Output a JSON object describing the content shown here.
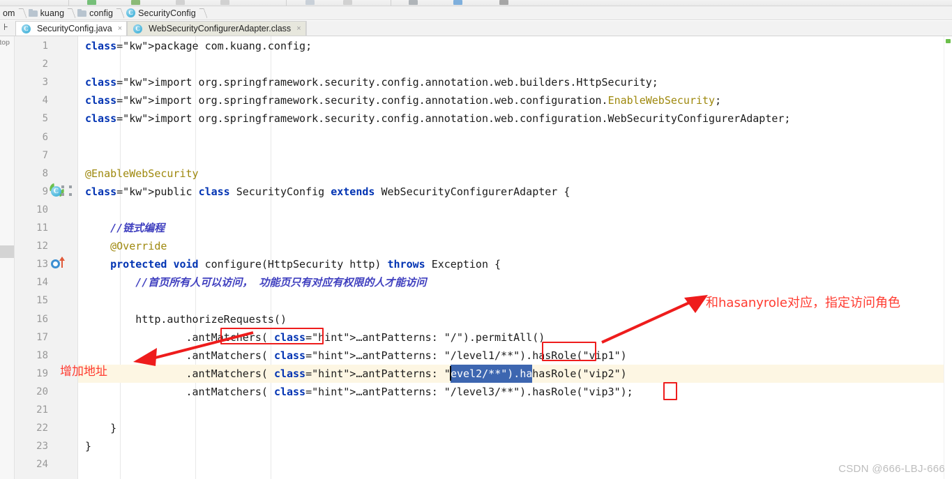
{
  "window": {
    "watermark": "CSDN @666-LBJ-666",
    "left_rail_label": "top"
  },
  "toolbar": {
    "icons": [
      "run-icon",
      "debug-icon",
      "stop-icon",
      "coverage-icon",
      "search-icon",
      "settings-icon",
      "vcs-icon",
      "build-icon",
      "profile-icon"
    ]
  },
  "breadcrumb": {
    "items": [
      {
        "label": "om",
        "icon": "none"
      },
      {
        "label": "kuang",
        "icon": "folder-icon"
      },
      {
        "label": "config",
        "icon": "folder-icon"
      },
      {
        "label": "SecurityConfig",
        "icon": "class-icon"
      }
    ]
  },
  "tabs": [
    {
      "label": "SecurityConfig.java",
      "icon": "java-class-icon",
      "active": true,
      "close": "×"
    },
    {
      "label": "WebSecurityConfigurerAdapter.class",
      "icon": "compiled-class-icon",
      "active": false,
      "close": "×"
    }
  ],
  "editor": {
    "current_line": 19,
    "lines": [
      {
        "n": "1",
        "text": "package com.kuang.config;"
      },
      {
        "n": "2",
        "text": ""
      },
      {
        "n": "3",
        "text": "import org.springframework.security.config.annotation.web.builders.HttpSecurity;"
      },
      {
        "n": "4",
        "text": "import org.springframework.security.config.annotation.web.configuration.EnableWebSecurity;"
      },
      {
        "n": "5",
        "text": "import org.springframework.security.config.annotation.web.configuration.WebSecurityConfigurerAdapter;"
      },
      {
        "n": "6",
        "text": ""
      },
      {
        "n": "7",
        "text": ""
      },
      {
        "n": "8",
        "text": "@EnableWebSecurity"
      },
      {
        "n": "9",
        "text": "public class SecurityConfig extends WebSecurityConfigurerAdapter {"
      },
      {
        "n": "10",
        "text": ""
      },
      {
        "n": "11",
        "text": "    //链式编程"
      },
      {
        "n": "12",
        "text": "    @Override"
      },
      {
        "n": "13",
        "text": "    protected void configure(HttpSecurity http) throws Exception {"
      },
      {
        "n": "14",
        "text": "        //首页所有人可以访问， 功能页只有对应有权限的人才能访问"
      },
      {
        "n": "15",
        "text": ""
      },
      {
        "n": "16",
        "text": "        http.authorizeRequests()"
      },
      {
        "n": "17",
        "text": "                .antMatchers( ...antPatterns: \"/\").permitAll()"
      },
      {
        "n": "18",
        "text": "                .antMatchers( ...antPatterns: \"/level1/**\").hasRole(\"vip1\")"
      },
      {
        "n": "19",
        "text": "                .antMatchers( ...antPatterns: \"/level2/**\").hasRole(\"vip2\")"
      },
      {
        "n": "20",
        "text": "                .antMatchers( ...antPatterns: \"/level3/**\").hasRole(\"vip3\");"
      },
      {
        "n": "21",
        "text": ""
      },
      {
        "n": "22",
        "text": "    }"
      },
      {
        "n": "23",
        "text": "}"
      },
      {
        "n": "24",
        "text": ""
      }
    ],
    "param_hint": "...antPatterns:",
    "selection_text": "evel2/**\").ha"
  },
  "annotations": [
    {
      "id": "left",
      "text": "增加地址",
      "color": "#ff3b30"
    },
    {
      "id": "right",
      "text": "和hasanyrole对应，指定访问角色",
      "color": "#ff3b30"
    }
  ],
  "highlight_boxes": [
    {
      "id": "antmatchers-box",
      "target": "antMatchers("
    },
    {
      "id": "hasrole-box",
      "target": "hasRole"
    },
    {
      "id": "semicolon-box",
      "target": ";"
    }
  ],
  "colors": {
    "keyword": "#0033b3",
    "annotation": "#9e880d",
    "string": "#067d17",
    "comment": "#3f3fbf",
    "selection": "#3d66b0",
    "current_line": "#fdf6e3",
    "red_marker": "#ee1c1c"
  }
}
